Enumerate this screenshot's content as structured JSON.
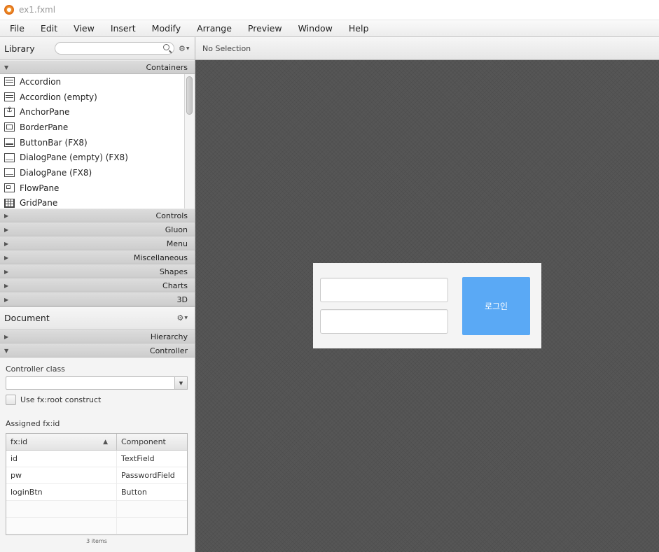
{
  "window": {
    "title": "ex1.fxml"
  },
  "menubar": {
    "items": [
      "File",
      "Edit",
      "View",
      "Insert",
      "Modify",
      "Arrange",
      "Preview",
      "Window",
      "Help"
    ]
  },
  "library": {
    "title": "Library",
    "search": {
      "value": "",
      "placeholder": ""
    },
    "sections": {
      "containers": "Containers",
      "collapsed": [
        "Controls",
        "Gluon",
        "Menu",
        "Miscellaneous",
        "Shapes",
        "Charts",
        "3D"
      ]
    },
    "items": [
      {
        "label": "Accordion",
        "icon": "accordion-icon"
      },
      {
        "label": "Accordion  (empty)",
        "icon": "accordion-icon"
      },
      {
        "label": "AnchorPane",
        "icon": "anchorpane-icon"
      },
      {
        "label": "BorderPane",
        "icon": "borderpane-icon"
      },
      {
        "label": "ButtonBar  (FX8)",
        "icon": "buttonbar-icon"
      },
      {
        "label": "DialogPane (empty)  (FX8)",
        "icon": "dialogpane-icon"
      },
      {
        "label": "DialogPane  (FX8)",
        "icon": "dialogpane-icon"
      },
      {
        "label": "FlowPane",
        "icon": "flowpane-icon"
      },
      {
        "label": "GridPane",
        "icon": "gridpane-icon"
      }
    ]
  },
  "document": {
    "title": "Document",
    "sections": {
      "hierarchy": "Hierarchy",
      "controller": "Controller"
    },
    "controller": {
      "class_label": "Controller class",
      "class_value": "",
      "fxroot_label": "Use fx:root construct",
      "assigned_label": "Assigned fx:id",
      "columns": [
        "fx:id",
        "Component"
      ],
      "rows": [
        {
          "fxid": "id",
          "component": "TextField"
        },
        {
          "fxid": "pw",
          "component": "PasswordField"
        },
        {
          "fxid": "loginBtn",
          "component": "Button"
        }
      ],
      "count": "3 items"
    }
  },
  "selection": {
    "status": "No Selection"
  },
  "canvas": {
    "id_field_value": "",
    "pw_field_value": "",
    "login_button_label": "로그인",
    "login_button_color": "#5aa9f5"
  }
}
